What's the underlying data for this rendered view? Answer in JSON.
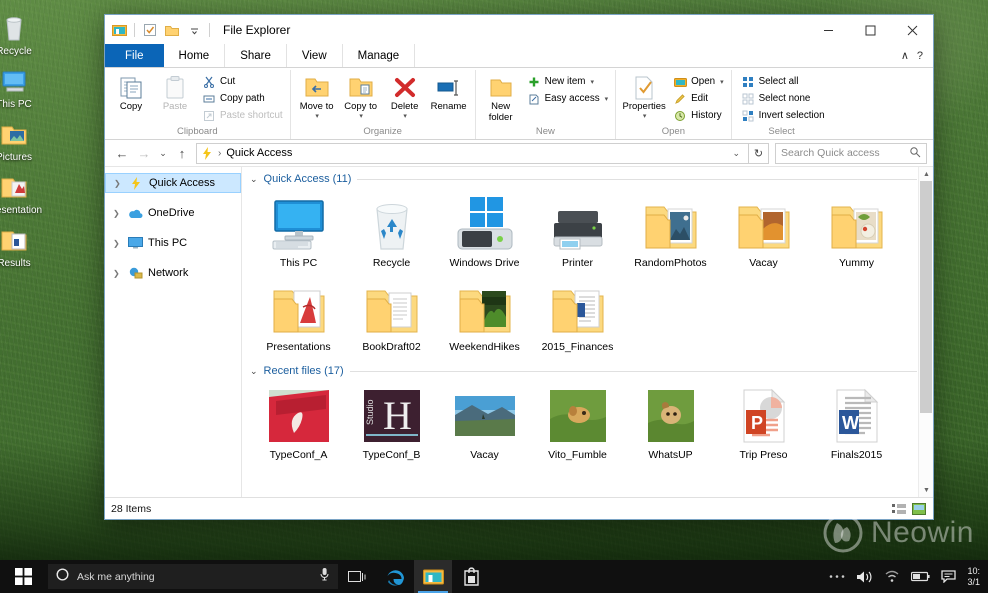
{
  "desktop": {
    "icons": [
      {
        "label": "Recycle",
        "icon": "recycle-bin-icon"
      },
      {
        "label": "This PC",
        "icon": "this-pc-icon"
      },
      {
        "label": "Pictures",
        "icon": "pictures-folder-icon"
      },
      {
        "label": "Presentation",
        "icon": "presentation-file-icon"
      },
      {
        "label": "Results",
        "icon": "results-file-icon"
      }
    ],
    "watermark": "Neowin"
  },
  "window": {
    "title": "File Explorer",
    "quick_access_toolbar": [
      {
        "name": "file-explorer-icon",
        "label": "File Explorer"
      },
      {
        "name": "properties-icon",
        "label": "Properties"
      },
      {
        "name": "new-folder-icon",
        "label": "New folder"
      },
      {
        "name": "customize-icon",
        "label": "Customize Quick Access Toolbar"
      }
    ],
    "controls": {
      "minimize": "─",
      "maximize": "□",
      "close": "✕",
      "collapse_ribbon": "∧",
      "help": "?"
    }
  },
  "tabs": [
    {
      "label": "File",
      "type": "file"
    },
    {
      "label": "Home",
      "type": "active"
    },
    {
      "label": "Share",
      "type": "normal"
    },
    {
      "label": "View",
      "type": "normal"
    },
    {
      "label": "Manage",
      "type": "normal"
    }
  ],
  "ribbon": {
    "groups": [
      {
        "title": "Clipboard",
        "big": [
          {
            "label": "Copy",
            "icon": "copy-icon",
            "disabled": false
          },
          {
            "label": "Paste",
            "icon": "paste-icon",
            "disabled": true
          }
        ],
        "small": [
          {
            "label": "Cut",
            "icon": "cut-icon",
            "disabled": false
          },
          {
            "label": "Copy path",
            "icon": "copy-path-icon",
            "disabled": false
          },
          {
            "label": "Paste shortcut",
            "icon": "paste-shortcut-icon",
            "disabled": true
          }
        ]
      },
      {
        "title": "Organize",
        "big": [
          {
            "label": "Move to",
            "icon": "move-to-icon",
            "dropdown": true
          },
          {
            "label": "Copy to",
            "icon": "copy-to-icon",
            "dropdown": true
          },
          {
            "label": "Delete",
            "icon": "delete-icon",
            "dropdown": true
          },
          {
            "label": "Rename",
            "icon": "rename-icon",
            "dropdown": false
          }
        ],
        "small": []
      },
      {
        "title": "New",
        "big": [
          {
            "label": "New folder",
            "icon": "new-folder-icon",
            "dropdown": false
          }
        ],
        "small": [
          {
            "label": "New item",
            "icon": "new-item-icon",
            "dropdown": true
          },
          {
            "label": "Easy access",
            "icon": "easy-access-icon",
            "dropdown": true
          }
        ]
      },
      {
        "title": "Open",
        "big": [
          {
            "label": "Properties",
            "icon": "properties-icon",
            "dropdown": true
          }
        ],
        "small": [
          {
            "label": "Open",
            "icon": "open-icon",
            "dropdown": true
          },
          {
            "label": "Edit",
            "icon": "edit-icon",
            "dropdown": false
          },
          {
            "label": "History",
            "icon": "history-icon",
            "dropdown": false
          }
        ]
      },
      {
        "title": "Select",
        "big": [],
        "small": [
          {
            "label": "Select all",
            "icon": "select-all-icon"
          },
          {
            "label": "Select none",
            "icon": "select-none-icon"
          },
          {
            "label": "Invert selection",
            "icon": "invert-selection-icon"
          }
        ]
      }
    ]
  },
  "addressbar": {
    "back": "←",
    "forward": "→",
    "recent": "⌄",
    "up": "↑",
    "crumb_icon": "lightning-bolt-icon",
    "crumb": "Quick Access",
    "separator": "›",
    "dropdown": "⌄",
    "refresh": "↻"
  },
  "search": {
    "placeholder": "Search Quick access",
    "icon": "search-icon"
  },
  "navpane": {
    "items": [
      {
        "label": "Quick Access",
        "icon": "lightning-bolt-icon",
        "selected": true
      },
      {
        "label": "OneDrive",
        "icon": "onedrive-cloud-icon",
        "selected": false
      },
      {
        "label": "This PC",
        "icon": "this-pc-icon",
        "selected": false
      },
      {
        "label": "Network",
        "icon": "network-icon",
        "selected": false
      }
    ]
  },
  "content": {
    "sections": [
      {
        "title": "Quick Access (11)",
        "items": [
          {
            "name": "This PC",
            "icon": "monitor-icon"
          },
          {
            "name": "Recycle",
            "icon": "recycle-bin-icon"
          },
          {
            "name": "Windows Drive",
            "icon": "windows-drive-icon"
          },
          {
            "name": "Printer",
            "icon": "printer-icon"
          },
          {
            "name": "RandomPhotos",
            "icon": "folder-photo-icon"
          },
          {
            "name": "Vacay",
            "icon": "folder-photo-icon"
          },
          {
            "name": "Yummy",
            "icon": "folder-photo-icon"
          },
          {
            "name": "Presentations",
            "icon": "folder-doc-icon"
          },
          {
            "name": "BookDraft02",
            "icon": "folder-doc-icon"
          },
          {
            "name": "WeekendHikes",
            "icon": "folder-photo-icon"
          },
          {
            "name": "2015_Finances",
            "icon": "folder-doc-icon"
          }
        ]
      },
      {
        "title": "Recent files (17)",
        "items": [
          {
            "name": "TypeConf_A",
            "icon": "image-thumbnail"
          },
          {
            "name": "TypeConf_B",
            "icon": "image-thumbnail"
          },
          {
            "name": "Vacay",
            "icon": "image-thumbnail"
          },
          {
            "name": "Vito_Fumble",
            "icon": "image-thumbnail"
          },
          {
            "name": "WhatsUP",
            "icon": "image-thumbnail"
          },
          {
            "name": "Trip Preso",
            "icon": "powerpoint-file-icon"
          },
          {
            "name": "Finals2015",
            "icon": "word-file-icon"
          }
        ]
      }
    ]
  },
  "statusbar": {
    "items_count": "28 Items",
    "views": [
      {
        "name": "details-view-icon",
        "active": false
      },
      {
        "name": "thumbnail-view-icon",
        "active": true
      }
    ]
  },
  "taskbar": {
    "start": "start-button-icon",
    "search_placeholder": "Ask me anything",
    "cortana_icon": "cortana-circle-icon",
    "mic_icon": "microphone-icon",
    "buttons": [
      {
        "name": "task-view-icon",
        "active": false
      },
      {
        "name": "edge-browser-icon",
        "active": false
      },
      {
        "name": "file-explorer-icon",
        "active": true
      },
      {
        "name": "store-icon",
        "active": false
      }
    ],
    "tray": [
      {
        "name": "tray-overflow-icon"
      },
      {
        "name": "volume-icon"
      },
      {
        "name": "wifi-icon"
      },
      {
        "name": "battery-icon"
      },
      {
        "name": "action-center-icon"
      }
    ],
    "clock": {
      "time": "10:",
      "date": "3/1"
    }
  },
  "colors": {
    "accent": "#0b65b7",
    "selection": "#cce8ff",
    "folder": "#ffd271",
    "word_blue": "#2b579a",
    "ppt_red": "#d04423"
  }
}
